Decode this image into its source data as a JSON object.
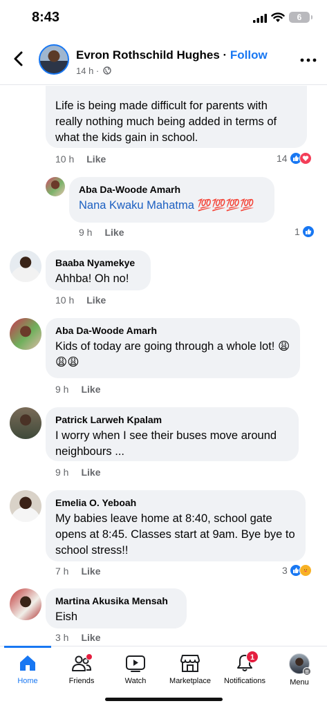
{
  "status_bar": {
    "time": "8:43",
    "battery": "6"
  },
  "post_header": {
    "author": "Evron Rothschild Hughes",
    "separator": " · ",
    "follow_label": "Follow",
    "time": "14 h ·"
  },
  "comments": [
    {
      "text": "Life is being made difficult for parents with really nothing much being added in terms of what the kids gain in school.",
      "time": "10 h",
      "like_label": "Like",
      "reactions_count": "14"
    },
    {
      "name": "Aba Da-Woode Amarh",
      "text": "Nana Kwaku Mahatma 💯💯💯💯",
      "time": "9 h",
      "like_label": "Like",
      "reactions_count": "1"
    },
    {
      "name": "Baaba Nyamekye",
      "text": "Ahhba! Oh no!",
      "time": "10 h",
      "like_label": "Like"
    },
    {
      "name": "Aba Da-Woode Amarh",
      "text": "Kids of today are going through a whole lot! 😩😩😩",
      "time": "9 h",
      "like_label": "Like"
    },
    {
      "name": "Patrick Larweh Kpalam",
      "text": "I worry when I see their buses move around neighbours ...",
      "time": "9 h",
      "like_label": "Like"
    },
    {
      "name": "Emelia O. Yeboah",
      "text": "My babies leave home at 8:40, school gate opens at 8:45. Classes start at 9am. Bye bye to school stress!!",
      "time": "7 h",
      "like_label": "Like",
      "reactions_count": "3"
    },
    {
      "name": "Martina Akusika Mensah",
      "text": "Eish",
      "time": "3 h",
      "like_label": "Like"
    }
  ],
  "bottom_nav": {
    "items": [
      {
        "label": "Home",
        "icon": "home-icon",
        "active": true
      },
      {
        "label": "Friends",
        "icon": "friends-icon"
      },
      {
        "label": "Watch",
        "icon": "watch-icon"
      },
      {
        "label": "Marketplace",
        "icon": "marketplace-icon"
      },
      {
        "label": "Notifications",
        "icon": "bell-icon",
        "badge": "1"
      },
      {
        "label": "Menu",
        "icon": "profile-avatar"
      }
    ]
  },
  "colors": {
    "accent": "#1877f2",
    "bubble": "#f0f2f5",
    "meta": "#65676b",
    "badge": "#e41e3f"
  }
}
